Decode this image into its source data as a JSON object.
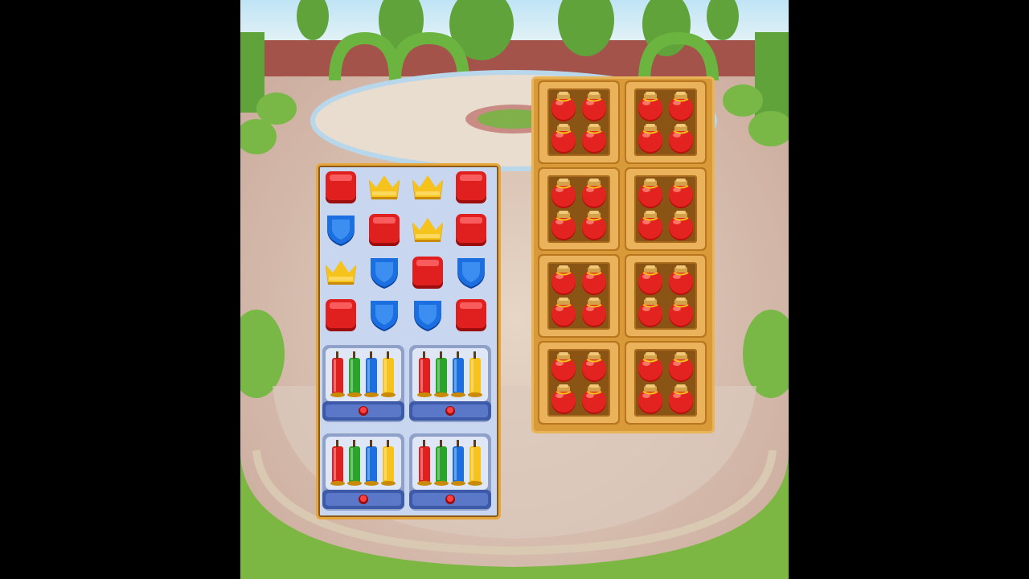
{
  "game": {
    "scene": "garden-courtyard"
  },
  "left_board": {
    "rows": [
      [
        "red-block",
        "crown",
        "crown",
        "red-block"
      ],
      [
        "shield",
        "red-block",
        "crown",
        "red-block"
      ],
      [
        "crown",
        "shield",
        "red-block",
        "shield"
      ],
      [
        "red-block",
        "shield",
        "shield",
        "red-block"
      ]
    ],
    "candle_boxes": [
      {
        "candles": [
          "red",
          "green",
          "blue",
          "yellow"
        ]
      },
      {
        "candles": [
          "red",
          "green",
          "blue",
          "yellow"
        ]
      },
      {
        "candles": [
          "red",
          "green",
          "blue",
          "yellow"
        ]
      },
      {
        "candles": [
          "red",
          "green",
          "blue",
          "yellow"
        ]
      }
    ]
  },
  "right_board": {
    "crates": [
      {
        "item": "red-jar",
        "count": 4
      },
      {
        "item": "red-jar",
        "count": 4
      },
      {
        "item": "red-jar",
        "count": 4
      },
      {
        "item": "red-jar",
        "count": 4
      },
      {
        "item": "red-jar",
        "count": 4
      },
      {
        "item": "red-jar",
        "count": 4
      },
      {
        "item": "red-jar",
        "count": 4
      },
      {
        "item": "red-jar",
        "count": 4
      }
    ]
  },
  "colors": {
    "board_frame": "#e7a63a",
    "board_fill": "#c9d6ef",
    "crate": "#d99a3a",
    "red": "#e01f1f",
    "blue": "#1b6fe0",
    "gold": "#f6c21c",
    "green": "#2aa42a"
  }
}
